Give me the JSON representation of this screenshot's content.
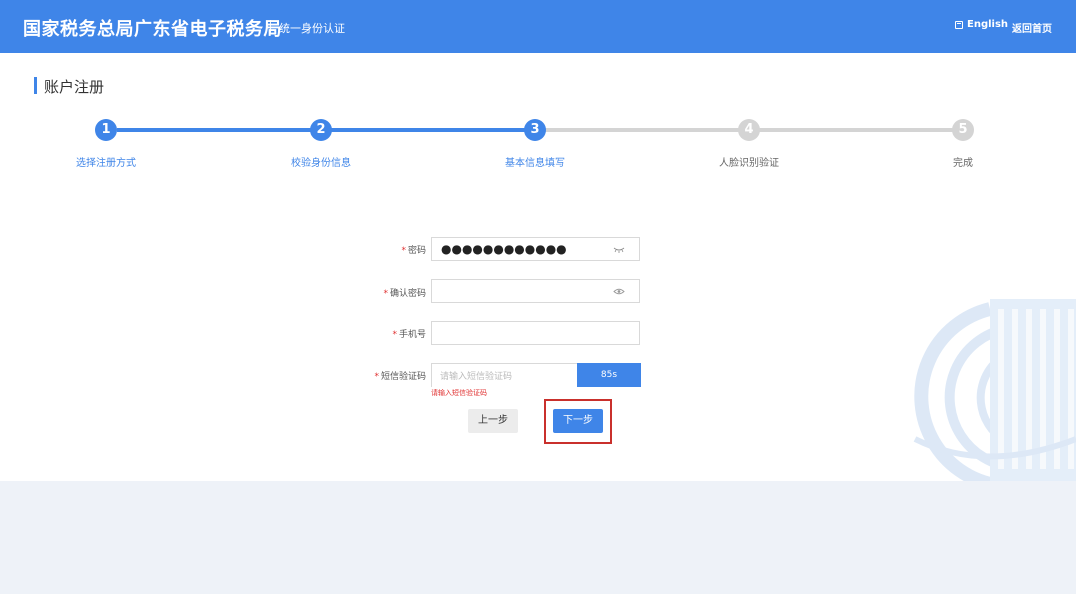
{
  "header": {
    "title": "国家税务总局广东省电子税务局",
    "subtitle": "统一身份认证",
    "lang_link": "English",
    "home_link": "返回首页",
    "color": "#3f85e8"
  },
  "page": {
    "title": "账户注册"
  },
  "stepper": {
    "current": 3,
    "steps": [
      {
        "number": "1",
        "label": "选择注册方式",
        "status": "done"
      },
      {
        "number": "2",
        "label": "校验身份信息",
        "status": "done"
      },
      {
        "number": "3",
        "label": "基本信息填写",
        "status": "current"
      },
      {
        "number": "4",
        "label": "人脸识别验证",
        "status": "todo"
      },
      {
        "number": "5",
        "label": "完成",
        "status": "todo"
      }
    ]
  },
  "form": {
    "required_mark": "*",
    "password": {
      "label": "密码",
      "value": "●●●●●●●●●●●●",
      "icon": "eye-closed-icon"
    },
    "confirm_password": {
      "label": "确认密码",
      "value": "",
      "icon": "eye-icon"
    },
    "phone": {
      "label": "手机号",
      "value": ""
    },
    "sms_code": {
      "label": "短信验证码",
      "placeholder": "请输入短信验证码",
      "button_label": "85s",
      "error": "请输入短信验证码"
    }
  },
  "actions": {
    "prev_label": "上一步",
    "next_label": "下一步"
  },
  "colors": {
    "primary": "#3f85e8",
    "error": "#e03131",
    "highlight": "#c9302c"
  }
}
